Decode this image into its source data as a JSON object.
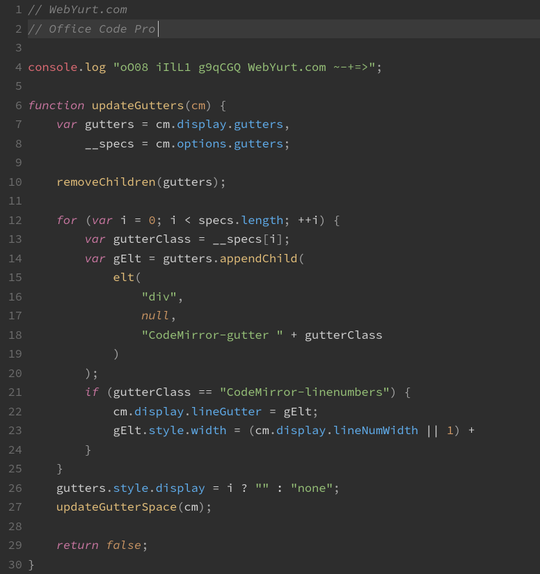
{
  "editor": {
    "theme": "Office Code Pro Dark",
    "current_line": 2,
    "lines": [
      {
        "n": 1,
        "tokens": [
          [
            "comment",
            "// WebYurt.com"
          ]
        ]
      },
      {
        "n": 2,
        "tokens": [
          [
            "comment",
            "// Office Code Pro"
          ]
        ]
      },
      {
        "n": 3,
        "tokens": []
      },
      {
        "n": 4,
        "tokens": [
          [
            "obj",
            "console"
          ],
          [
            "punct",
            "."
          ],
          [
            "call",
            "log"
          ],
          [
            "var",
            " "
          ],
          [
            "str",
            "\"oO08 iIlL1 g9qCGQ WebYurt.com ~-+=>\""
          ],
          [
            "punct",
            ";"
          ]
        ]
      },
      {
        "n": 5,
        "tokens": []
      },
      {
        "n": 6,
        "tokens": [
          [
            "keyword",
            "function"
          ],
          [
            "var",
            " "
          ],
          [
            "func",
            "updateGutters"
          ],
          [
            "punct",
            "("
          ],
          [
            "param",
            "cm"
          ],
          [
            "punct",
            ") {"
          ]
        ]
      },
      {
        "n": 7,
        "tokens": [
          [
            "var",
            "    "
          ],
          [
            "storage",
            "var"
          ],
          [
            "var",
            " gutters "
          ],
          [
            "op",
            "="
          ],
          [
            "var",
            " cm"
          ],
          [
            "punct",
            "."
          ],
          [
            "prop",
            "display"
          ],
          [
            "punct",
            "."
          ],
          [
            "prop",
            "gutters"
          ],
          [
            "punct",
            ","
          ]
        ]
      },
      {
        "n": 8,
        "tokens": [
          [
            "var",
            "        __specs "
          ],
          [
            "op",
            "="
          ],
          [
            "var",
            " cm"
          ],
          [
            "punct",
            "."
          ],
          [
            "prop",
            "options"
          ],
          [
            "punct",
            "."
          ],
          [
            "prop",
            "gutters"
          ],
          [
            "punct",
            ";"
          ]
        ]
      },
      {
        "n": 9,
        "tokens": []
      },
      {
        "n": 10,
        "tokens": [
          [
            "var",
            "    "
          ],
          [
            "call",
            "removeChildren"
          ],
          [
            "punct",
            "("
          ],
          [
            "var",
            "gutters"
          ],
          [
            "punct",
            ");"
          ]
        ]
      },
      {
        "n": 11,
        "tokens": []
      },
      {
        "n": 12,
        "tokens": [
          [
            "var",
            "    "
          ],
          [
            "keyword",
            "for"
          ],
          [
            "var",
            " "
          ],
          [
            "punct",
            "("
          ],
          [
            "storage",
            "var"
          ],
          [
            "var",
            " i "
          ],
          [
            "op",
            "="
          ],
          [
            "var",
            " "
          ],
          [
            "num",
            "0"
          ],
          [
            "punct",
            "; "
          ],
          [
            "var",
            "i "
          ],
          [
            "op",
            "<"
          ],
          [
            "var",
            " specs"
          ],
          [
            "punct",
            "."
          ],
          [
            "prop",
            "length"
          ],
          [
            "punct",
            "; "
          ],
          [
            "op",
            "++"
          ],
          [
            "var",
            "i"
          ],
          [
            "punct",
            ") {"
          ]
        ]
      },
      {
        "n": 13,
        "tokens": [
          [
            "var",
            "        "
          ],
          [
            "storage",
            "var"
          ],
          [
            "var",
            " gutterClass "
          ],
          [
            "op",
            "="
          ],
          [
            "var",
            " __specs"
          ],
          [
            "punct",
            "["
          ],
          [
            "var",
            "i"
          ],
          [
            "punct",
            "];"
          ]
        ]
      },
      {
        "n": 14,
        "tokens": [
          [
            "var",
            "        "
          ],
          [
            "storage",
            "var"
          ],
          [
            "var",
            " gElt "
          ],
          [
            "op",
            "="
          ],
          [
            "var",
            " gutters"
          ],
          [
            "punct",
            "."
          ],
          [
            "call",
            "appendChild"
          ],
          [
            "punct",
            "("
          ]
        ]
      },
      {
        "n": 15,
        "tokens": [
          [
            "var",
            "            "
          ],
          [
            "call",
            "elt"
          ],
          [
            "punct",
            "("
          ]
        ]
      },
      {
        "n": 16,
        "tokens": [
          [
            "var",
            "                "
          ],
          [
            "str",
            "\"div\""
          ],
          [
            "punct",
            ","
          ]
        ]
      },
      {
        "n": 17,
        "tokens": [
          [
            "var",
            "                "
          ],
          [
            "const",
            "null"
          ],
          [
            "punct",
            ","
          ]
        ]
      },
      {
        "n": 18,
        "tokens": [
          [
            "var",
            "                "
          ],
          [
            "str",
            "\"CodeMirror-gutter \""
          ],
          [
            "var",
            " "
          ],
          [
            "op",
            "+"
          ],
          [
            "var",
            " gutterClass"
          ]
        ]
      },
      {
        "n": 19,
        "tokens": [
          [
            "var",
            "            "
          ],
          [
            "punct",
            ")"
          ]
        ]
      },
      {
        "n": 20,
        "tokens": [
          [
            "var",
            "        "
          ],
          [
            "punct",
            ");"
          ]
        ]
      },
      {
        "n": 21,
        "tokens": [
          [
            "var",
            "        "
          ],
          [
            "keyword",
            "if"
          ],
          [
            "var",
            " "
          ],
          [
            "punct",
            "("
          ],
          [
            "var",
            "gutterClass "
          ],
          [
            "op",
            "=="
          ],
          [
            "var",
            " "
          ],
          [
            "str",
            "\"CodeMirror-linenumbers\""
          ],
          [
            "punct",
            ") {"
          ]
        ]
      },
      {
        "n": 22,
        "tokens": [
          [
            "var",
            "            cm"
          ],
          [
            "punct",
            "."
          ],
          [
            "prop",
            "display"
          ],
          [
            "punct",
            "."
          ],
          [
            "prop",
            "lineGutter"
          ],
          [
            "var",
            " "
          ],
          [
            "op",
            "="
          ],
          [
            "var",
            " gElt"
          ],
          [
            "punct",
            ";"
          ]
        ]
      },
      {
        "n": 23,
        "tokens": [
          [
            "var",
            "            gElt"
          ],
          [
            "punct",
            "."
          ],
          [
            "prop",
            "style"
          ],
          [
            "punct",
            "."
          ],
          [
            "prop",
            "width"
          ],
          [
            "var",
            " "
          ],
          [
            "op",
            "="
          ],
          [
            "var",
            " "
          ],
          [
            "punct",
            "("
          ],
          [
            "var",
            "cm"
          ],
          [
            "punct",
            "."
          ],
          [
            "prop",
            "display"
          ],
          [
            "punct",
            "."
          ],
          [
            "prop",
            "lineNumWidth"
          ],
          [
            "var",
            " "
          ],
          [
            "op",
            "||"
          ],
          [
            "var",
            " "
          ],
          [
            "num",
            "1"
          ],
          [
            "punct",
            ") "
          ],
          [
            "op",
            "+"
          ]
        ]
      },
      {
        "n": 24,
        "tokens": [
          [
            "var",
            "        "
          ],
          [
            "punct",
            "}"
          ]
        ]
      },
      {
        "n": 25,
        "tokens": [
          [
            "var",
            "    "
          ],
          [
            "punct",
            "}"
          ]
        ]
      },
      {
        "n": 26,
        "tokens": [
          [
            "var",
            "    gutters"
          ],
          [
            "punct",
            "."
          ],
          [
            "prop",
            "style"
          ],
          [
            "punct",
            "."
          ],
          [
            "prop",
            "display"
          ],
          [
            "var",
            " "
          ],
          [
            "op",
            "="
          ],
          [
            "var",
            " i "
          ],
          [
            "op",
            "?"
          ],
          [
            "var",
            " "
          ],
          [
            "str",
            "\"\""
          ],
          [
            "var",
            " "
          ],
          [
            "op",
            ":"
          ],
          [
            "var",
            " "
          ],
          [
            "str",
            "\"none\""
          ],
          [
            "punct",
            ";"
          ]
        ]
      },
      {
        "n": 27,
        "tokens": [
          [
            "var",
            "    "
          ],
          [
            "call",
            "updateGutterSpace"
          ],
          [
            "punct",
            "("
          ],
          [
            "var",
            "cm"
          ],
          [
            "punct",
            ");"
          ]
        ]
      },
      {
        "n": 28,
        "tokens": []
      },
      {
        "n": 29,
        "tokens": [
          [
            "var",
            "    "
          ],
          [
            "keyword",
            "return"
          ],
          [
            "var",
            " "
          ],
          [
            "const",
            "false"
          ],
          [
            "punct",
            ";"
          ]
        ]
      },
      {
        "n": 30,
        "tokens": [
          [
            "punct",
            "}"
          ]
        ]
      }
    ]
  }
}
